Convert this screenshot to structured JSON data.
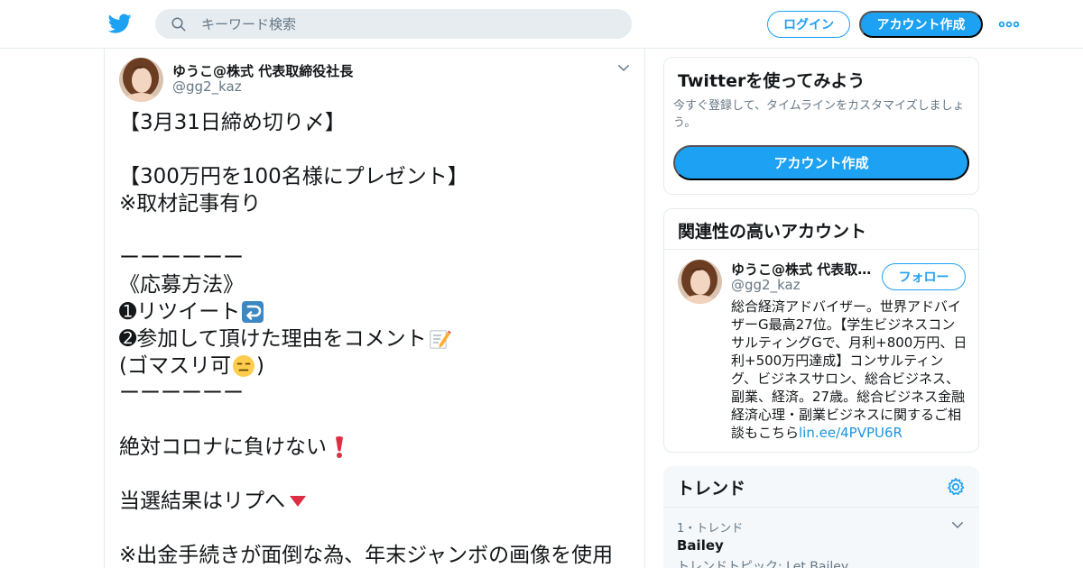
{
  "header": {
    "search_placeholder": "キーワード検索",
    "login_label": "ログイン",
    "signup_label": "アカウント作成",
    "logo_icon": "twitter-bird-icon",
    "more_icon": "more-dots-icon"
  },
  "tweet": {
    "display_name": "ゆうこ@株式 代表取締役社長",
    "handle": "@gg2_kaz",
    "lines": [
      "【3月31日締め切り〆】",
      "",
      "【300万円を100名様にプレゼント】",
      "※取材記事有り",
      "",
      "ーーーーーー",
      "《応募方法》",
      "➊リツイート",
      "➋参加して頂けた理由をコメント",
      "(ゴマスリ可",
      "ーーーーーー",
      "",
      "絶対コロナに負けない",
      "",
      "当選結果はリプへ",
      "",
      "※出金手続きが面倒な為、年末ジャンボの画像を使用"
    ],
    "line_suffix_paren": ")"
  },
  "signup_card": {
    "title": "Twitterを使ってみよう",
    "description": "今すぐ登録して、タイムラインをカスタマイズしましょう。",
    "button_label": "アカウント作成"
  },
  "related_card": {
    "title": "関連性の高いアカウント",
    "account": {
      "display_name": "ゆうこ@株式 代表取締役社長",
      "handle": "@gg2_kaz",
      "follow_label": "フォロー",
      "bio": "総合経済アドバイザー。世界アドバイザーG最高27位。【学生ビジネスコンサルティングGで、月利+800万円、日利+500万円達成】コンサルティング、ビジネスサロン、総合ビジネス、副業、経済。27歳。総合ビジネス金融経済心理・副業ビジネスに関するご相談もこちら",
      "bio_link": "lin.ee/4PVPU6R"
    }
  },
  "trends_card": {
    "title": "トレンド",
    "items": [
      {
        "meta": "1・トレンド",
        "name": "Bailey",
        "topic": "トレンドトピック: Let Bailey"
      }
    ]
  },
  "colors": {
    "accent": "#1da1f2",
    "text": "#14171a",
    "muted": "#657786",
    "border": "#e6ecf0"
  }
}
